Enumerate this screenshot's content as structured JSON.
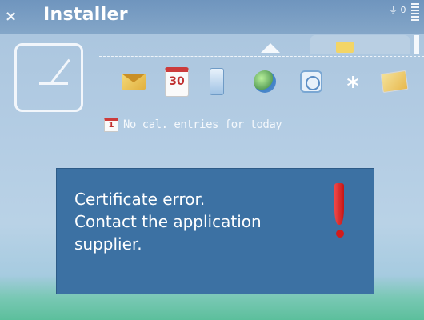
{
  "window": {
    "title": "Installer"
  },
  "status_bar": {
    "indicator": "0"
  },
  "shortcut_icons": [
    "mail-icon",
    "calendar-icon",
    "phone-icon",
    "web-globe-icon",
    "clock-icon",
    "bluetooth-icon",
    "messages-icon"
  ],
  "calendar_shortcut": {
    "day": "30"
  },
  "calendar_entry": {
    "day": "1",
    "text": "No cal. entries for today"
  },
  "dialog": {
    "message_lines": [
      "Certificate error.",
      "Contact the application",
      "supplier."
    ],
    "icon": "exclamation-icon"
  },
  "colors": {
    "accent": "#3c71a3",
    "alert": "#d21b1b"
  }
}
